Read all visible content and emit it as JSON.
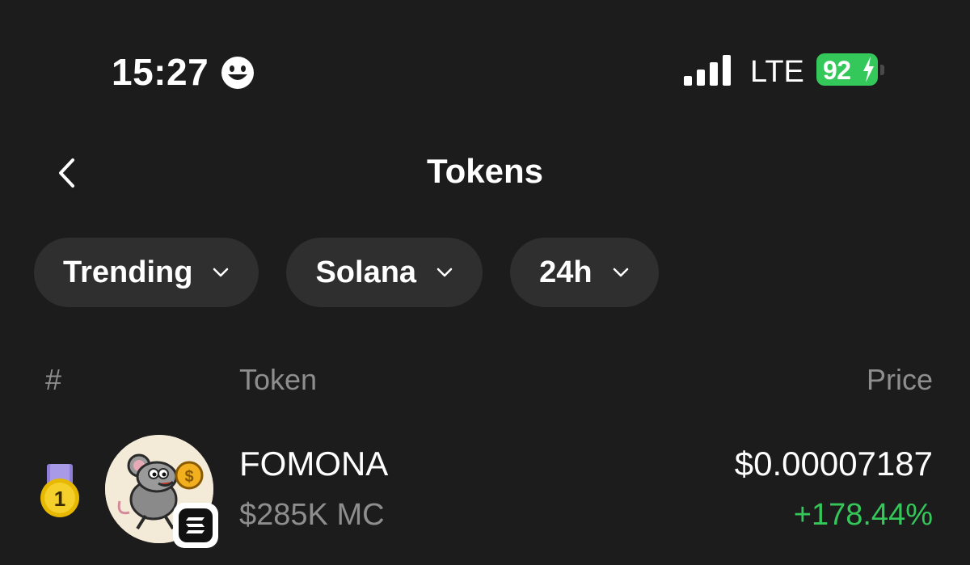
{
  "status_bar": {
    "time": "15:27",
    "network": "LTE",
    "battery": "92",
    "battery_color": "#34c759",
    "icons": [
      "smiley-emoji-icon",
      "signal-bars-icon",
      "charging-bolt-icon"
    ]
  },
  "nav": {
    "title": "Tokens",
    "back_icon": "chevron-left-icon"
  },
  "filters": [
    {
      "label": "Trending"
    },
    {
      "label": "Solana"
    },
    {
      "label": "24h"
    }
  ],
  "table": {
    "headers": {
      "rank": "#",
      "token": "Token",
      "price": "Price"
    },
    "rows": [
      {
        "rank": "1",
        "name": "FOMONA",
        "market_cap": "$285K MC",
        "price": "$0.00007187",
        "change": "+178.44%",
        "change_color": "#34c759",
        "logo_icon": "mouse-with-coin-icon",
        "chain_icon": "solana-icon"
      }
    ]
  }
}
